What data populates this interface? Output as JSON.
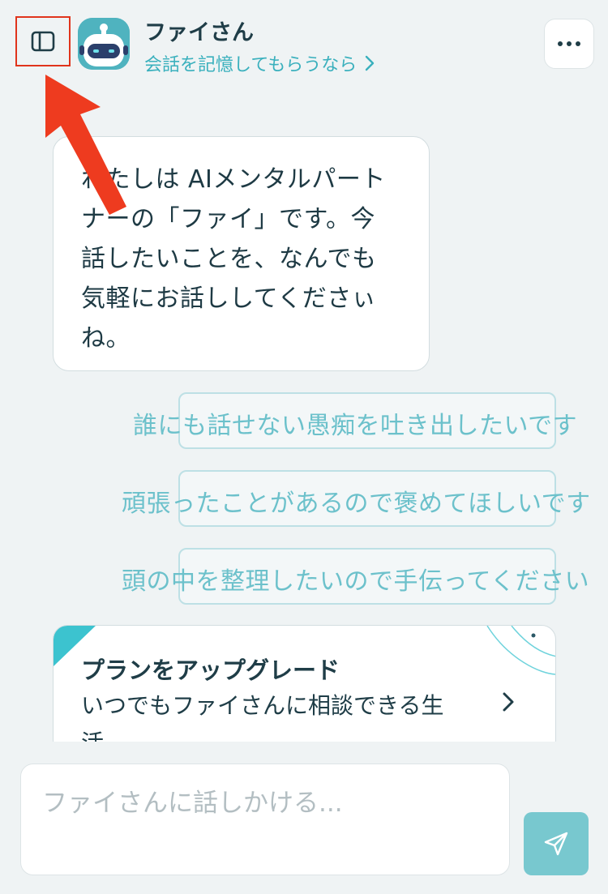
{
  "header": {
    "title": "ファイさん",
    "subtitle": "会話を記憶してもらうなら"
  },
  "chat": {
    "messages": [
      {
        "sender": "assistant",
        "lines": [
          "わたしは AIメンタルパート",
          "ナーの「ファイ」です。今",
          "話したいことを、なんでも",
          "気軽にお話ししてくださぃ",
          "ね。"
        ]
      }
    ],
    "suggestions": [
      "誰にも話せない愚痴を吐き出したいです",
      "頑張ったことがあるので褒めてほしいです",
      "頭の中を整理したいので手伝ってください"
    ]
  },
  "upgrade": {
    "title": "プランをアップグレード",
    "description": "いつでもファイさんに相談できる生活"
  },
  "composer": {
    "placeholder": "ファイさんに話しかける..."
  },
  "icons": {
    "sidebar_toggle": "sidebar-panel-icon",
    "avatar": "robot-avatar-icon",
    "more": "more-horizontal-icon",
    "subtitle_chevron": "chevron-right-icon",
    "upgrade_chevron": "chevron-right-icon",
    "send": "paper-plane-icon"
  },
  "colors": {
    "accent": "#3ab0bd",
    "chip_text": "#6cc1cb",
    "send_button": "#78c8cf",
    "annotation": "#e0341c",
    "background": "#eff3f4"
  }
}
